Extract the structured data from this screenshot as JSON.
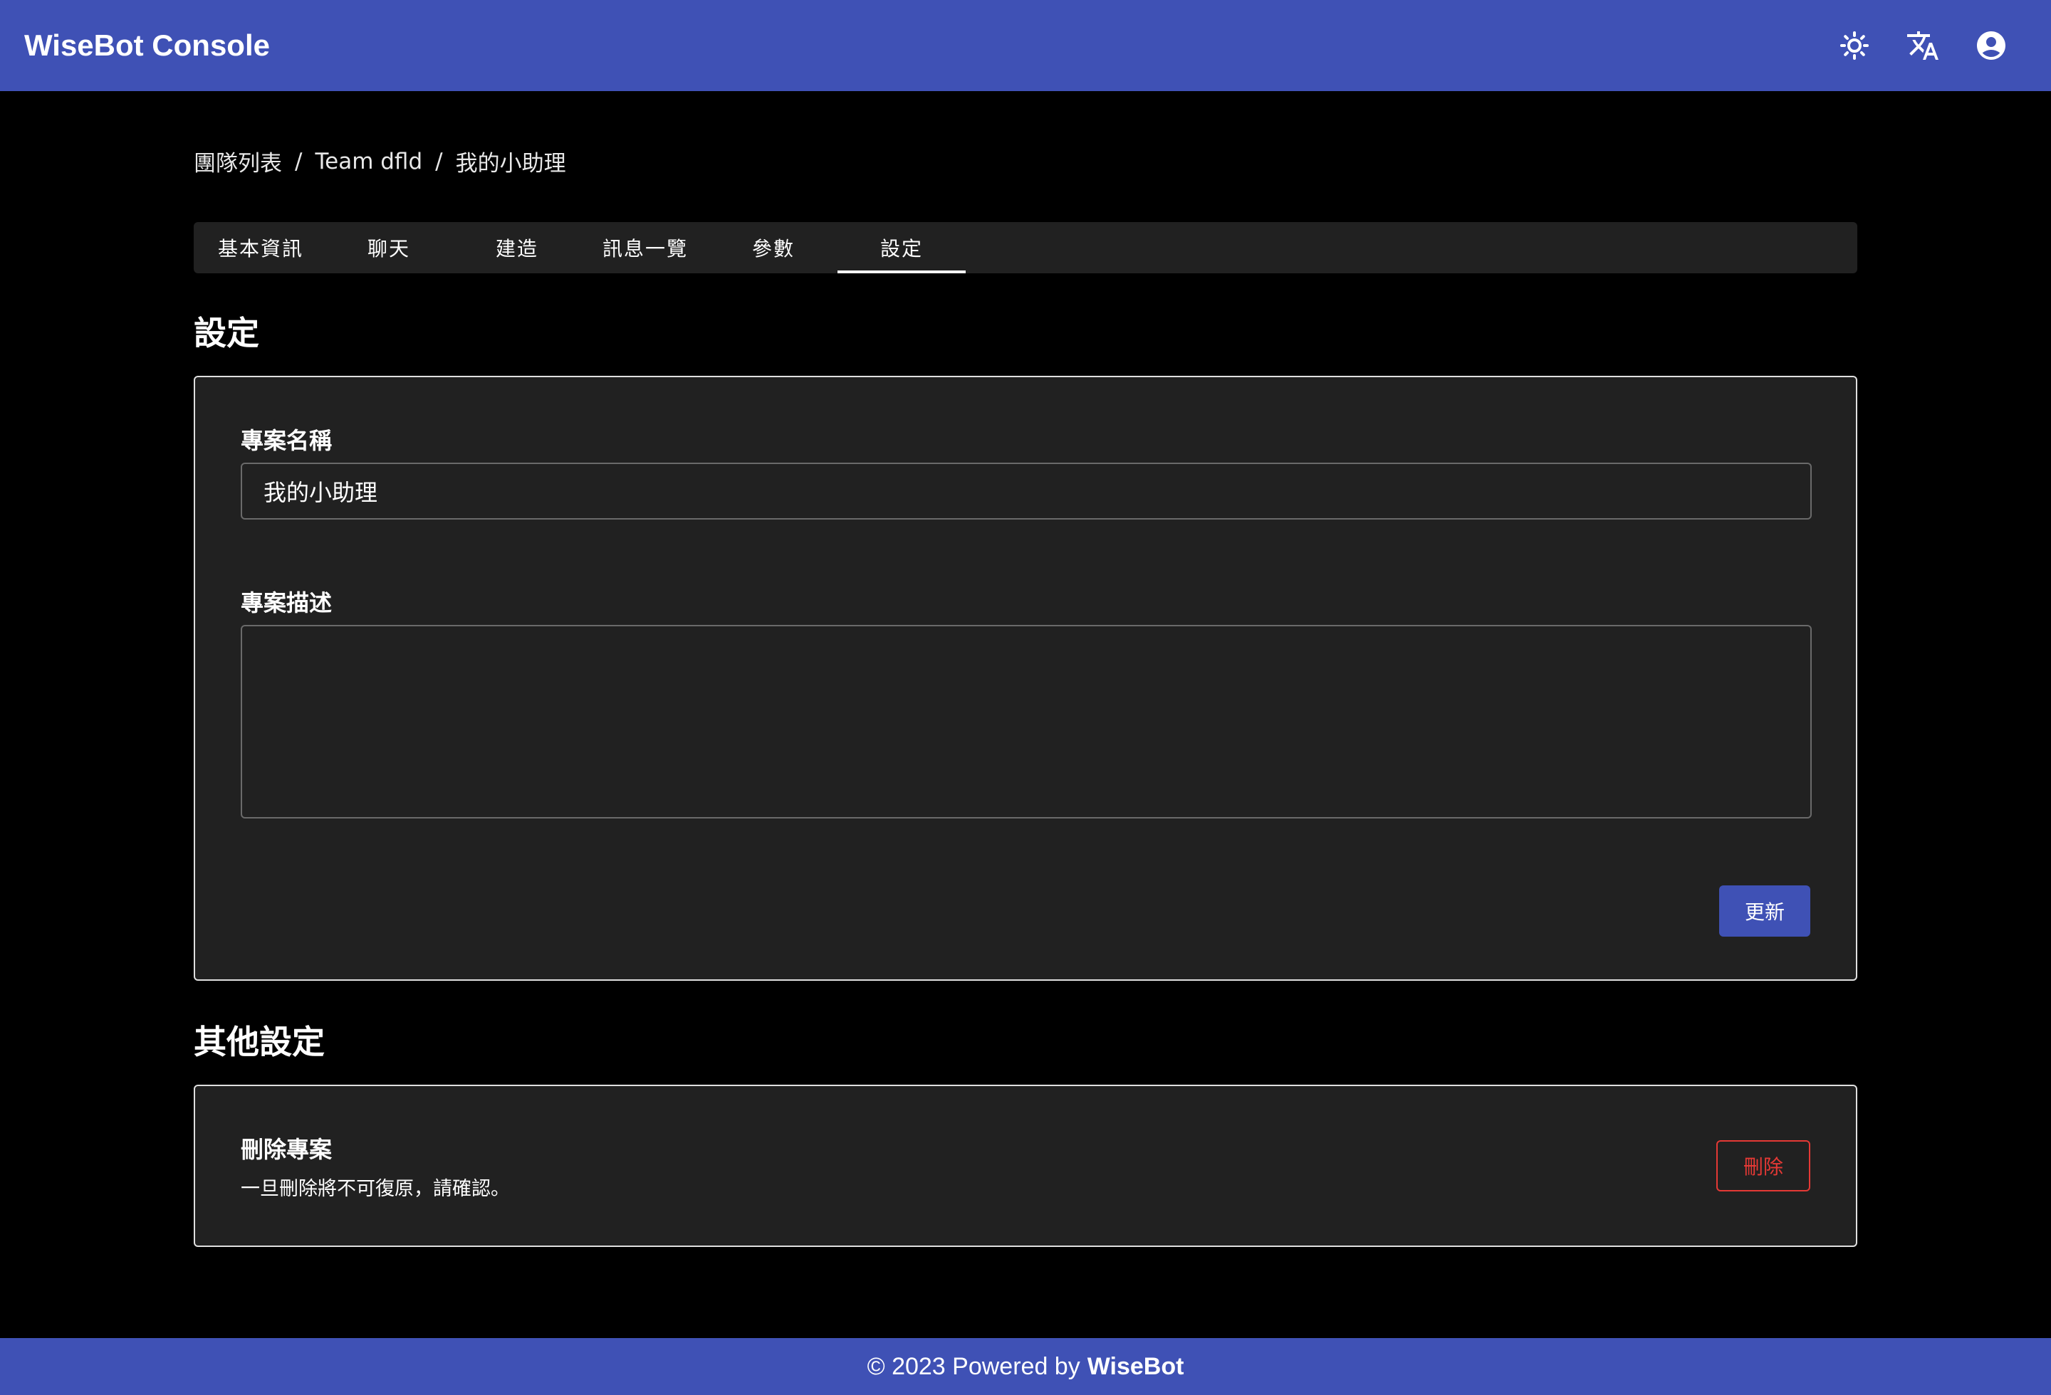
{
  "header": {
    "title": "WiseBot Console",
    "icons": [
      "theme-brightness-icon",
      "translate-icon",
      "account-icon"
    ]
  },
  "breadcrumb": {
    "items": [
      "團隊列表",
      "Team dfld",
      "我的小助理"
    ],
    "separator": "/"
  },
  "tabs": {
    "items": [
      "基本資訊",
      "聊天",
      "建造",
      "訊息一覽",
      "參數",
      "設定"
    ],
    "active": "設定"
  },
  "settings": {
    "section_title": "設定",
    "name_label": "專案名稱",
    "name_value": "我的小助理",
    "description_label": "專案描述",
    "description_value": "",
    "update_button": "更新"
  },
  "other_settings": {
    "section_title": "其他設定",
    "delete_title": "刪除專案",
    "delete_description": "一旦刪除將不可復原，請確認。",
    "delete_button": "刪除"
  },
  "footer": {
    "prefix": "© 2023 Powered by",
    "brand": "WiseBot"
  },
  "colors": {
    "primary": "#3f51b5",
    "background": "#000000",
    "card": "#212121",
    "danger": "#e53935"
  }
}
